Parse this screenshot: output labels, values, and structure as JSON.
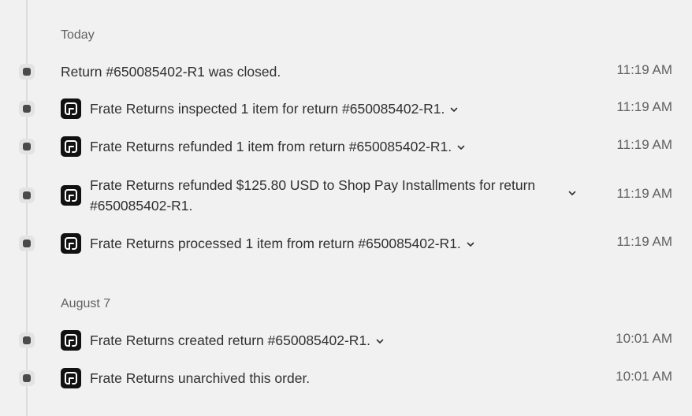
{
  "groups": [
    {
      "heading": "Today"
    },
    {
      "heading": "August 7"
    }
  ],
  "events": [
    {
      "message": "Return #650085402-R1 was closed.",
      "time": "11:19 AM"
    },
    {
      "message": "Frate Returns inspected 1 item for return #650085402-R1.",
      "time": "11:19 AM"
    },
    {
      "message": "Frate Returns refunded 1 item from return #650085402-R1.",
      "time": "11:19 AM"
    },
    {
      "message_line1": "Frate Returns refunded $125.80 USD to Shop Pay Installments for return",
      "message_line2": "#650085402-R1.",
      "time": "11:19 AM"
    },
    {
      "message": "Frate Returns processed 1 item from return #650085402-R1.",
      "time": "11:19 AM"
    },
    {
      "message": "Frate Returns created return #650085402-R1.",
      "time": "10:01 AM"
    },
    {
      "message": "Frate Returns unarchived this order.",
      "time": "10:01 AM"
    }
  ],
  "icons": {
    "app_logo": "frate-returns-logo-icon",
    "expand": "chevron-down-icon",
    "timeline_marker": "timeline-dot-icon"
  }
}
